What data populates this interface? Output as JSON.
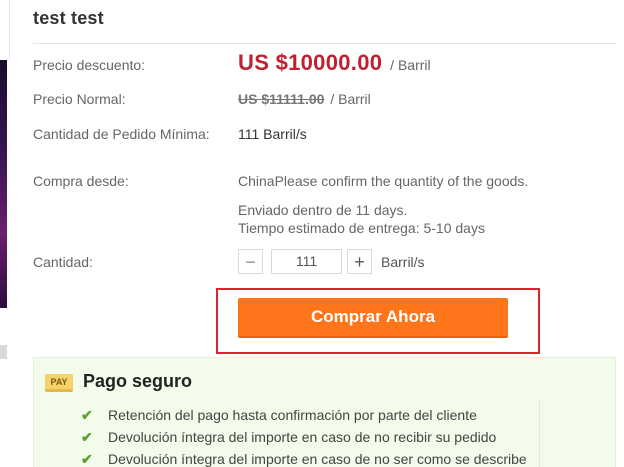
{
  "product": {
    "title": "test test"
  },
  "pricing": {
    "discount_label": "Precio descuento:",
    "discount_price": "US $10000.00",
    "discount_unit": "/ Barril",
    "normal_label": "Precio Normal:",
    "normal_price": "US $11111.00",
    "normal_unit": "/ Barril",
    "min_order_label": "Cantidad de Pedido Mínima:",
    "min_order_value": "111 Barril/s"
  },
  "shipping": {
    "label": "Compra desde:",
    "origin": "ChinaPlease confirm the quantity of the goods.",
    "dispatch": "Enviado dentro de 11 days.",
    "delivery": "Tiempo estimado de entrega: 5-10 days"
  },
  "quantity": {
    "label": "Cantidad:",
    "minus": "−",
    "value": "111",
    "plus": "+",
    "unit": "Barril/s"
  },
  "actions": {
    "buy_now": "Comprar Ahora"
  },
  "secure_payment": {
    "badge": "PAY",
    "title": "Pago seguro",
    "items": [
      "Retención del pago hasta confirmación por parte del cliente",
      "Devolución íntegra del importe en caso de no recibir su pedido",
      "Devolución íntegra del importe en caso de no ser como se describe"
    ]
  },
  "colors": {
    "price": "#c0202f",
    "buy_button": "#ff7519",
    "highlight_border": "#d9262c",
    "secure_bg": "#f3fbea",
    "check": "#5aa12b"
  }
}
